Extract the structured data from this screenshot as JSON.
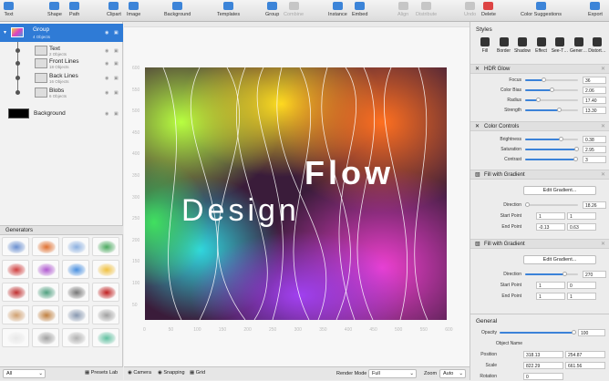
{
  "toolbar": {
    "buttons": [
      {
        "label": "Text",
        "icon": "text-icon",
        "enabled": true
      },
      {
        "label": "Shape",
        "icon": "shape-icon",
        "enabled": true
      },
      {
        "label": "Path",
        "icon": "path-icon",
        "enabled": true
      },
      {
        "label": "Clipart",
        "icon": "clipart-icon",
        "enabled": true
      },
      {
        "label": "Image",
        "icon": "image-icon",
        "enabled": true
      },
      {
        "label": "Background",
        "icon": "background-icon",
        "enabled": true
      },
      {
        "label": "Templates",
        "icon": "templates-icon",
        "enabled": true
      },
      {
        "label": "Group",
        "icon": "group-icon",
        "enabled": true
      },
      {
        "label": "Combine",
        "icon": "combine-icon",
        "enabled": false
      },
      {
        "label": "Instance",
        "icon": "instance-icon",
        "enabled": true
      },
      {
        "label": "Embed",
        "icon": "embed-icon",
        "enabled": true
      },
      {
        "label": "Align",
        "icon": "align-icon",
        "enabled": false
      },
      {
        "label": "Distribute",
        "icon": "distribute-icon",
        "enabled": false
      },
      {
        "label": "Undo",
        "icon": "undo-icon",
        "enabled": false
      },
      {
        "label": "Delete",
        "icon": "delete-icon",
        "enabled": true
      },
      {
        "label": "Color Suggestions",
        "icon": "color-suggestions-icon",
        "enabled": true
      },
      {
        "label": "Export",
        "icon": "export-icon",
        "enabled": true
      }
    ]
  },
  "layers": {
    "group": {
      "name": "Group",
      "count": "4 Objects"
    },
    "children": [
      {
        "name": "Text",
        "count": "2 Objects"
      },
      {
        "name": "Front Lines",
        "count": "18 Objects"
      },
      {
        "name": "Back Lines",
        "count": "16 Objects"
      },
      {
        "name": "Blobs",
        "count": "6 Objects"
      }
    ],
    "background": {
      "name": "Background"
    }
  },
  "generators": {
    "title": "Generators",
    "filter": "All",
    "presets_label": "Presets Lab",
    "thumbs": [
      "#6a8fd0",
      "#e07030",
      "#8cb0e0",
      "#4caa60",
      "#d04040",
      "#b05ad0",
      "#4a90e0",
      "#f0c040",
      "#c03030",
      "#50a080",
      "#777777",
      "#c02020",
      "#d0a070",
      "#c08040",
      "#8898b0",
      "#a0a0a0",
      "#e8e8e8",
      "#a0a0a0",
      "#b0b0b0",
      "#60c0a0"
    ]
  },
  "canvas": {
    "artwork_text_1": "Flow",
    "artwork_text_2": "Design",
    "ruler_x": [
      "0",
      "50",
      "100",
      "150",
      "200",
      "250",
      "300",
      "350",
      "400",
      "450",
      "500",
      "550",
      "600"
    ],
    "ruler_y": [
      "600",
      "550",
      "500",
      "450",
      "400",
      "350",
      "300",
      "250",
      "200",
      "150",
      "100",
      "50"
    ]
  },
  "bottombar": {
    "camera": "Camera",
    "snapping": "Snapping",
    "grid": "Grid",
    "render_mode_label": "Render Mode",
    "render_mode_value": "Full",
    "zoom_label": "Zoom",
    "zoom_value": "Auto"
  },
  "styles": {
    "title": "Styles",
    "tabs": [
      {
        "label": "Fill",
        "icon": "fill-icon"
      },
      {
        "label": "Border",
        "icon": "border-icon"
      },
      {
        "label": "Shadow",
        "icon": "shadow-icon"
      },
      {
        "label": "Effect",
        "icon": "effect-icon"
      },
      {
        "label": "See-T…",
        "icon": "see-through-icon"
      },
      {
        "label": "Gener…",
        "icon": "generator-icon"
      },
      {
        "label": "Distort…",
        "icon": "distort-icon"
      }
    ],
    "hdr_glow": {
      "title": "HDR Glow",
      "params": [
        {
          "label": "Focus",
          "value": "36",
          "level": 0.36
        },
        {
          "label": "Color Bias",
          "value": "2.06",
          "level": 0.52
        },
        {
          "label": "Radius",
          "value": "17.40",
          "level": 0.25
        },
        {
          "label": "Strength",
          "value": "13.30",
          "level": 0.66
        }
      ]
    },
    "color_controls": {
      "title": "Color Controls",
      "params": [
        {
          "label": "Brightness",
          "value": "0.38",
          "level": 0.69
        },
        {
          "label": "Saturation",
          "value": "2.95",
          "level": 0.98
        },
        {
          "label": "Contrast",
          "value": "3",
          "level": 0.97
        }
      ]
    },
    "gradient_1": {
      "title": "Fill with Gradient",
      "button": "Edit Gradient...",
      "direction_label": "Direction",
      "direction_value": "18.26",
      "direction_level": 0.05,
      "start_label": "Start Point",
      "start": [
        "1",
        "1"
      ],
      "end_label": "End Point",
      "end": [
        "-0.13",
        "0.63"
      ]
    },
    "gradient_2": {
      "title": "Fill with Gradient",
      "button": "Edit Gradient...",
      "direction_label": "Direction",
      "direction_value": "270",
      "direction_level": 0.75,
      "start_label": "Start Point",
      "start": [
        "1",
        "0"
      ],
      "end_label": "End Point",
      "end": [
        "1",
        "1"
      ]
    }
  },
  "general": {
    "title": "General",
    "opacity_label": "Opacity",
    "opacity_value": "100",
    "opacity_level": 1.0,
    "object_name_label": "Object Name",
    "position_label": "Position",
    "position": [
      "318.13",
      "254.87"
    ],
    "scale_label": "Scale",
    "scale": [
      "822.29",
      "661.56"
    ],
    "rotation_label": "Rotation",
    "rotation": "0"
  },
  "colors": {
    "accent": "#2f7bd6",
    "toolbar_icon": "#3c84d8",
    "delete": "#dd4444"
  }
}
